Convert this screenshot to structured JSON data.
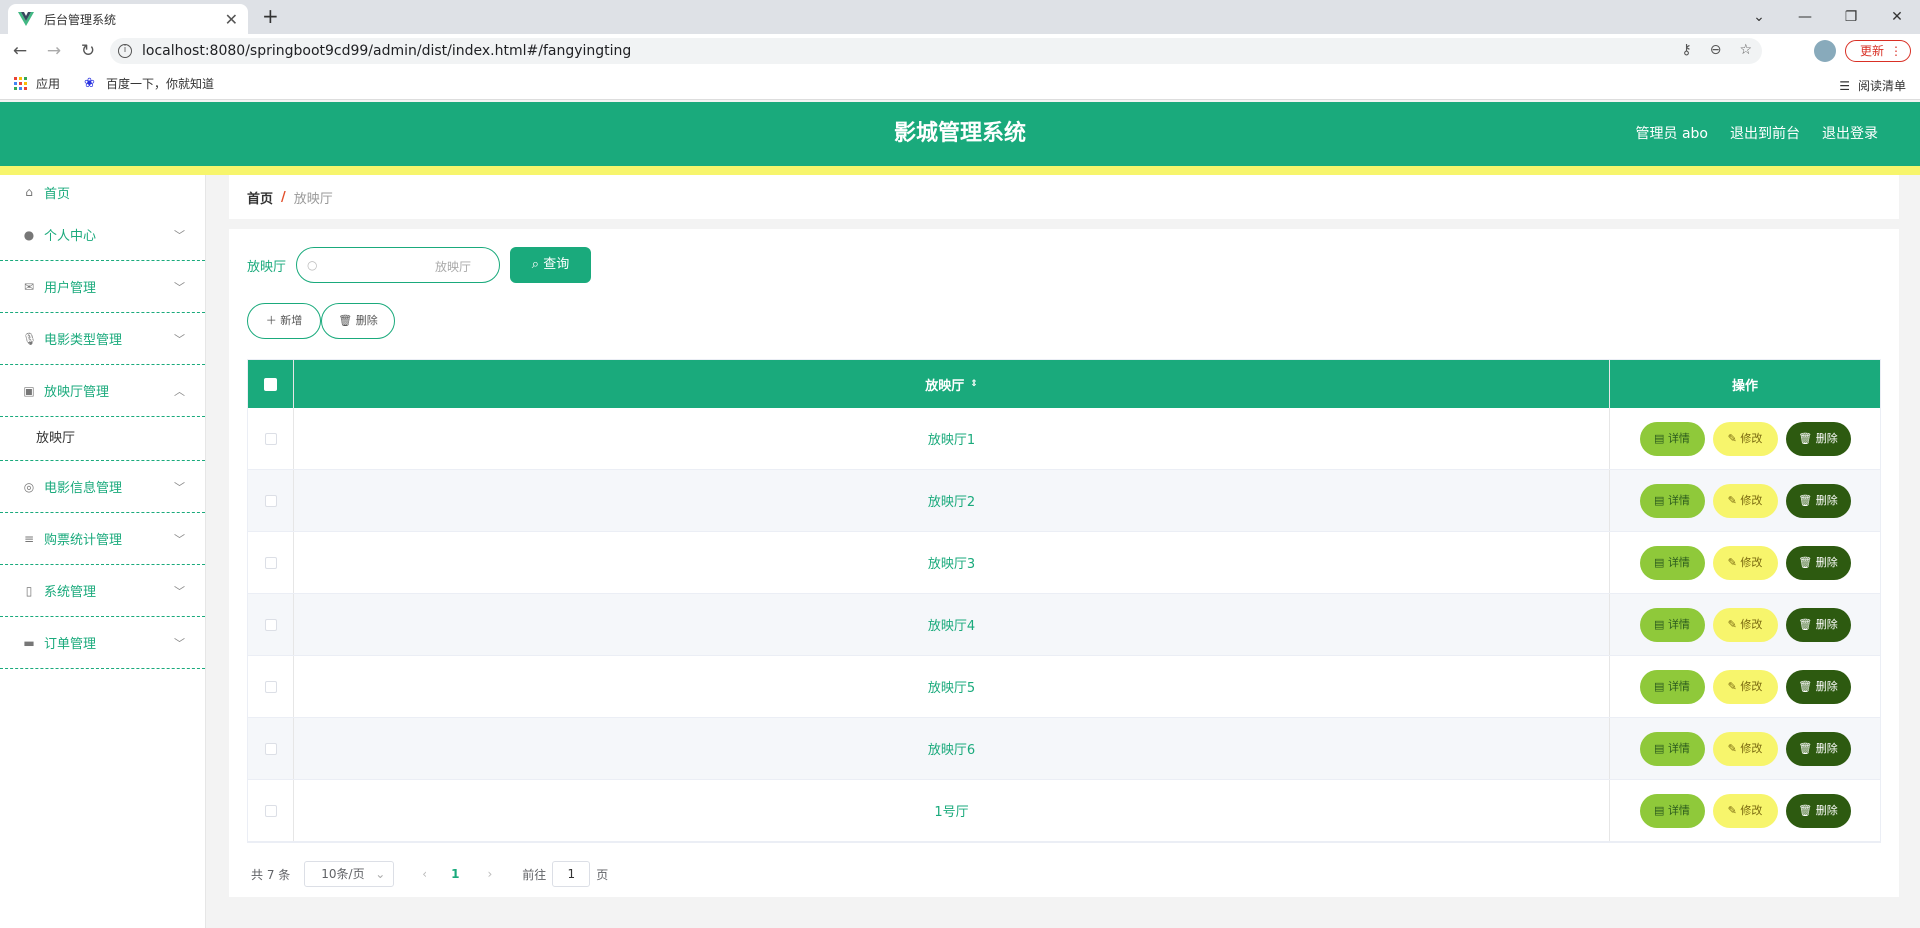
{
  "browser": {
    "tab_title": "后台管理系统",
    "url": "localhost:8080/springboot9cd99/admin/dist/index.html#/fangyingting",
    "update_label": "更新",
    "bookmarks": [
      "应用",
      "百度一下，你就知道"
    ],
    "reading_list": "阅读清单"
  },
  "header": {
    "title": "影城管理系统",
    "user": "管理员 abo",
    "to_front": "退出到前台",
    "logout": "退出登录"
  },
  "sidebar": {
    "home": "首页",
    "items": [
      "个人中心",
      "用户管理",
      "电影类型管理",
      "放映厅管理",
      "电影信息管理",
      "购票统计管理",
      "系统管理",
      "订单管理"
    ],
    "sub_item": "放映厅"
  },
  "breadcrumb": {
    "home": "首页",
    "sep": "/",
    "current": "放映厅"
  },
  "search": {
    "label": "放映厅",
    "placeholder": "放映厅",
    "button": "查询"
  },
  "actions": {
    "add": "新增",
    "delete": "删除"
  },
  "table": {
    "headers": [
      "放映厅",
      "操作"
    ],
    "rows": [
      "放映厅1",
      "放映厅2",
      "放映厅3",
      "放映厅4",
      "放映厅5",
      "放映厅6",
      "1号厅"
    ],
    "btn_detail": "详情",
    "btn_edit": "修改",
    "btn_delete": "删除"
  },
  "pager": {
    "total": "共 7 条",
    "page_size": "10条/页",
    "current": "1",
    "goto_prefix": "前往",
    "goto_value": "1",
    "goto_suffix": "页"
  },
  "colors": {
    "primary": "#1aaa7c",
    "accent_bar": "#f7f56c",
    "detail": "#8fc93a",
    "edit": "#f7f56c",
    "delete": "#2d5a10"
  }
}
